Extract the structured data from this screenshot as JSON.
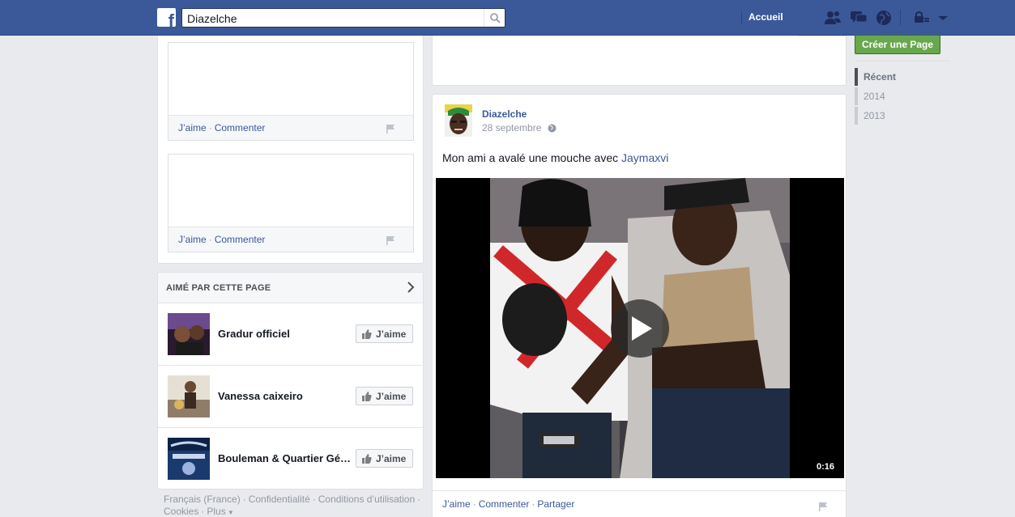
{
  "topbar": {
    "search_value": "Diazelche",
    "home_label": "Accueil"
  },
  "left": {
    "mini_posts": [
      {
        "like": "J’aime",
        "comment": "Commenter"
      },
      {
        "like": "J’aime",
        "comment": "Commenter"
      }
    ],
    "liked_by": {
      "title": "AIMÉ PAR CETTE PAGE",
      "items": [
        {
          "name": "Gradur officiel",
          "button": "J’aime"
        },
        {
          "name": "Vanessa caixeiro",
          "button": "J’aime"
        },
        {
          "name": "Bouleman & Quartier Gé…",
          "button": "J’aime"
        }
      ]
    },
    "footer": {
      "lang": "Français (France)",
      "privacy": "Confidentialité",
      "terms": "Conditions d’utilisation",
      "cookies": "Cookies",
      "more": "Plus"
    }
  },
  "post": {
    "author": "Diazelche",
    "date": "28 septembre",
    "text_prefix": "Mon ami a avalé une mouche avec ",
    "mention": "Jaymaxvi",
    "video_duration": "0:16",
    "actions": {
      "like": "J’aime",
      "comment": "Commenter",
      "share": "Partager"
    }
  },
  "right": {
    "create_page": "Créer une Page",
    "years": [
      "Récent",
      "2014",
      "2013"
    ]
  },
  "colors": {
    "brand": "#3b5998",
    "green": "#69a74e",
    "background": "#e9eaed"
  }
}
